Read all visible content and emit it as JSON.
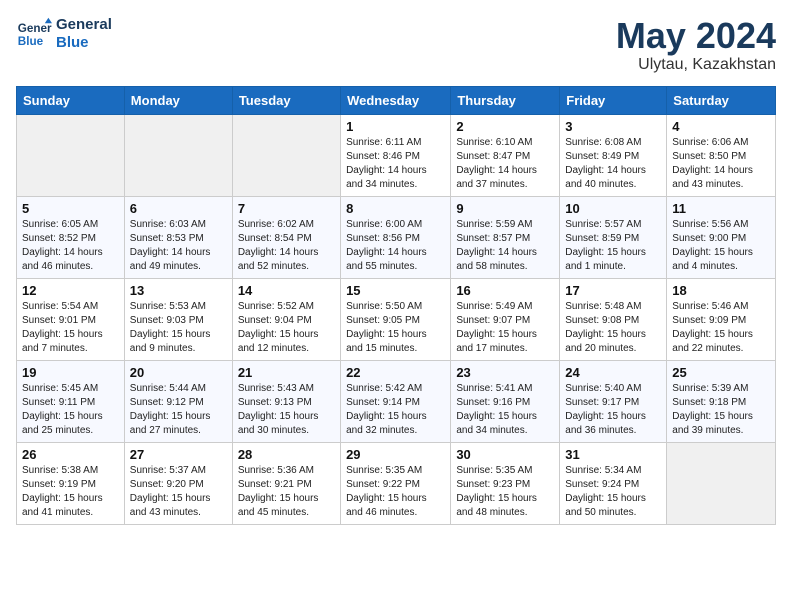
{
  "header": {
    "logo_line1": "General",
    "logo_line2": "Blue",
    "month": "May 2024",
    "location": "Ulytau, Kazakhstan"
  },
  "weekdays": [
    "Sunday",
    "Monday",
    "Tuesday",
    "Wednesday",
    "Thursday",
    "Friday",
    "Saturday"
  ],
  "weeks": [
    [
      {
        "day": "",
        "info": ""
      },
      {
        "day": "",
        "info": ""
      },
      {
        "day": "",
        "info": ""
      },
      {
        "day": "1",
        "info": "Sunrise: 6:11 AM\nSunset: 8:46 PM\nDaylight: 14 hours\nand 34 minutes."
      },
      {
        "day": "2",
        "info": "Sunrise: 6:10 AM\nSunset: 8:47 PM\nDaylight: 14 hours\nand 37 minutes."
      },
      {
        "day": "3",
        "info": "Sunrise: 6:08 AM\nSunset: 8:49 PM\nDaylight: 14 hours\nand 40 minutes."
      },
      {
        "day": "4",
        "info": "Sunrise: 6:06 AM\nSunset: 8:50 PM\nDaylight: 14 hours\nand 43 minutes."
      }
    ],
    [
      {
        "day": "5",
        "info": "Sunrise: 6:05 AM\nSunset: 8:52 PM\nDaylight: 14 hours\nand 46 minutes."
      },
      {
        "day": "6",
        "info": "Sunrise: 6:03 AM\nSunset: 8:53 PM\nDaylight: 14 hours\nand 49 minutes."
      },
      {
        "day": "7",
        "info": "Sunrise: 6:02 AM\nSunset: 8:54 PM\nDaylight: 14 hours\nand 52 minutes."
      },
      {
        "day": "8",
        "info": "Sunrise: 6:00 AM\nSunset: 8:56 PM\nDaylight: 14 hours\nand 55 minutes."
      },
      {
        "day": "9",
        "info": "Sunrise: 5:59 AM\nSunset: 8:57 PM\nDaylight: 14 hours\nand 58 minutes."
      },
      {
        "day": "10",
        "info": "Sunrise: 5:57 AM\nSunset: 8:59 PM\nDaylight: 15 hours\nand 1 minute."
      },
      {
        "day": "11",
        "info": "Sunrise: 5:56 AM\nSunset: 9:00 PM\nDaylight: 15 hours\nand 4 minutes."
      }
    ],
    [
      {
        "day": "12",
        "info": "Sunrise: 5:54 AM\nSunset: 9:01 PM\nDaylight: 15 hours\nand 7 minutes."
      },
      {
        "day": "13",
        "info": "Sunrise: 5:53 AM\nSunset: 9:03 PM\nDaylight: 15 hours\nand 9 minutes."
      },
      {
        "day": "14",
        "info": "Sunrise: 5:52 AM\nSunset: 9:04 PM\nDaylight: 15 hours\nand 12 minutes."
      },
      {
        "day": "15",
        "info": "Sunrise: 5:50 AM\nSunset: 9:05 PM\nDaylight: 15 hours\nand 15 minutes."
      },
      {
        "day": "16",
        "info": "Sunrise: 5:49 AM\nSunset: 9:07 PM\nDaylight: 15 hours\nand 17 minutes."
      },
      {
        "day": "17",
        "info": "Sunrise: 5:48 AM\nSunset: 9:08 PM\nDaylight: 15 hours\nand 20 minutes."
      },
      {
        "day": "18",
        "info": "Sunrise: 5:46 AM\nSunset: 9:09 PM\nDaylight: 15 hours\nand 22 minutes."
      }
    ],
    [
      {
        "day": "19",
        "info": "Sunrise: 5:45 AM\nSunset: 9:11 PM\nDaylight: 15 hours\nand 25 minutes."
      },
      {
        "day": "20",
        "info": "Sunrise: 5:44 AM\nSunset: 9:12 PM\nDaylight: 15 hours\nand 27 minutes."
      },
      {
        "day": "21",
        "info": "Sunrise: 5:43 AM\nSunset: 9:13 PM\nDaylight: 15 hours\nand 30 minutes."
      },
      {
        "day": "22",
        "info": "Sunrise: 5:42 AM\nSunset: 9:14 PM\nDaylight: 15 hours\nand 32 minutes."
      },
      {
        "day": "23",
        "info": "Sunrise: 5:41 AM\nSunset: 9:16 PM\nDaylight: 15 hours\nand 34 minutes."
      },
      {
        "day": "24",
        "info": "Sunrise: 5:40 AM\nSunset: 9:17 PM\nDaylight: 15 hours\nand 36 minutes."
      },
      {
        "day": "25",
        "info": "Sunrise: 5:39 AM\nSunset: 9:18 PM\nDaylight: 15 hours\nand 39 minutes."
      }
    ],
    [
      {
        "day": "26",
        "info": "Sunrise: 5:38 AM\nSunset: 9:19 PM\nDaylight: 15 hours\nand 41 minutes."
      },
      {
        "day": "27",
        "info": "Sunrise: 5:37 AM\nSunset: 9:20 PM\nDaylight: 15 hours\nand 43 minutes."
      },
      {
        "day": "28",
        "info": "Sunrise: 5:36 AM\nSunset: 9:21 PM\nDaylight: 15 hours\nand 45 minutes."
      },
      {
        "day": "29",
        "info": "Sunrise: 5:35 AM\nSunset: 9:22 PM\nDaylight: 15 hours\nand 46 minutes."
      },
      {
        "day": "30",
        "info": "Sunrise: 5:35 AM\nSunset: 9:23 PM\nDaylight: 15 hours\nand 48 minutes."
      },
      {
        "day": "31",
        "info": "Sunrise: 5:34 AM\nSunset: 9:24 PM\nDaylight: 15 hours\nand 50 minutes."
      },
      {
        "day": "",
        "info": ""
      }
    ]
  ]
}
